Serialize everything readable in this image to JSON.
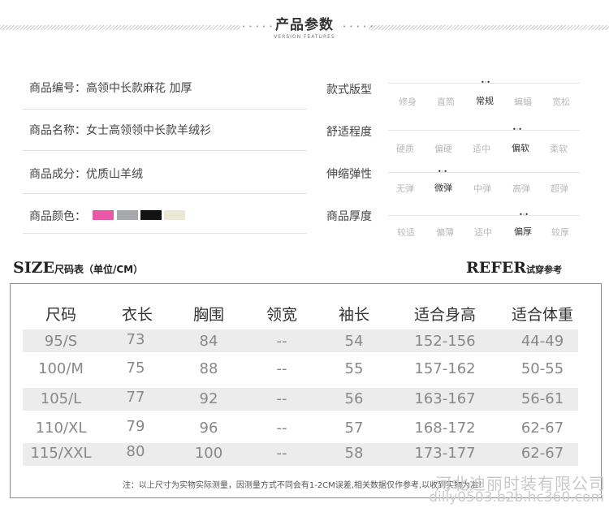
{
  "header": {
    "title": "产品参数",
    "subtitle": "VERSION FEATURES",
    "left_dots": "• • • • •",
    "right_dots": "• • • • •"
  },
  "info": [
    {
      "label": "商品编号：",
      "value": "高领中长款麻花 加厚"
    },
    {
      "label": "商品名称：",
      "value": "女士高领领中长款羊绒衫"
    },
    {
      "label": "商品成分：",
      "value": "优质山羊绒"
    },
    {
      "label": "商品颜色：",
      "value": ""
    }
  ],
  "colors": [
    "#e85aa8",
    "#a7a8ac",
    "#121212",
    "#ece8d6"
  ],
  "specs": [
    {
      "label": "款式版型",
      "options": [
        "修身",
        "直筒",
        "常规",
        "蝙蝠",
        "宽松"
      ],
      "selected": 2
    },
    {
      "label": "舒适程度",
      "options": [
        "硬质",
        "偏硬",
        "适中",
        "偏软",
        "柔软"
      ],
      "selected": 3
    },
    {
      "label": "伸缩弹性",
      "options": [
        "无弹",
        "微弹",
        "中弹",
        "高弹",
        "超弹"
      ],
      "selected": 1
    },
    {
      "label": "商品厚度",
      "options": [
        "较适",
        "偏薄",
        "适中",
        "偏厚",
        "较厚"
      ],
      "selected": 3
    }
  ],
  "size_title": {
    "main": "SIZE",
    "rest": "尺码表（单位/CM）"
  },
  "refer_title": {
    "main": "REFER",
    "rest": "试穿参考"
  },
  "size_table": {
    "headers": [
      "尺码",
      "衣长",
      "胸围",
      "领宽",
      "袖长",
      "适合身高",
      "适合体重"
    ],
    "rows": [
      [
        "95/S",
        "73",
        "84",
        "--",
        "54",
        "152-156",
        "44-49"
      ],
      [
        "100/M",
        "75",
        "88",
        "--",
        "55",
        "157-162",
        "50-55"
      ],
      [
        "105/L",
        "77",
        "92",
        "--",
        "56",
        "163-167",
        "56-61"
      ],
      [
        "110/XL",
        "79",
        "96",
        "--",
        "57",
        "168-172",
        "62-67"
      ],
      [
        "115/XXL",
        "80",
        "100",
        "--",
        "58",
        "173-177",
        "62-67"
      ]
    ]
  },
  "note": "注：以上尺寸为实物实际测量，因测量方式不同会有1-2CM误差,相关数据仅作参考,以收到实物为准！",
  "watermark": {
    "company": "河北迪丽时装有限公司",
    "url": "dilly0503.b2b.hc360.com"
  }
}
